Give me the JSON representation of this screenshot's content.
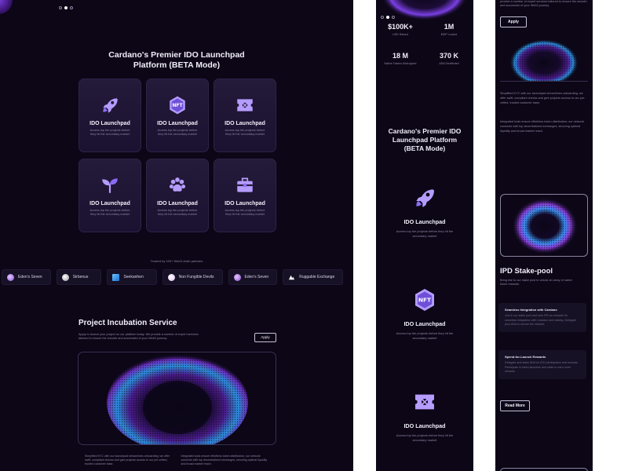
{
  "desktop": {
    "title_line1": "Cardano's Premier IDO Launchpad",
    "title_line2": "Platform (BETA Mode)",
    "cards": [
      {
        "title": "IDO Launchpad",
        "desc": "Access top tier projects before they hit the secondary market",
        "icon": "rocket-icon"
      },
      {
        "title": "IDO Launchpad",
        "desc": "Access top tier projects before they hit the secondary market",
        "icon": "nft-hexagon-icon"
      },
      {
        "title": "IDO Launchpad",
        "desc": "Access top tier projects before they hit the secondary market",
        "icon": "ticket-icon"
      },
      {
        "title": "IDO Launchpad",
        "desc": "Access top tier projects before they hit the secondary market",
        "icon": "sprout-icon"
      },
      {
        "title": "IDO Launchpad",
        "desc": "Access top tier projects before they hit the secondary market",
        "icon": "paw-icon"
      },
      {
        "title": "IDO Launchpad",
        "desc": "Access top tier projects before they hit the secondary market",
        "icon": "toolbox-icon"
      }
    ],
    "trusted": "Trusted by 100+ Web3 chain partners",
    "partners": [
      {
        "name": "Eden's Seven",
        "color": "#c7a0e8"
      },
      {
        "name": "Sirbenus",
        "color": "#d9d9d9"
      },
      {
        "name": "Seekanhen",
        "color": "#3aa0ff"
      },
      {
        "name": "Non Fungible Devils",
        "color": "#f1e6f7"
      },
      {
        "name": "Eden's Seven",
        "color": "#c7a0e8"
      },
      {
        "name": "Ruggable Exchange",
        "color": "#ffffff"
      }
    ],
    "pis_title": "Project Incubation Service",
    "pis_desc": "Apply to launch your project on our platform today. We provide a number of expert services tailored to ensure the smooth and successful of your Web3 journey.",
    "apply": "Apply",
    "footer_left": "Simplified KYC with our launchpad streamlines onboarding; we offer swift, compliant checks and give projects access to our pre-vetted, trusted customer base.",
    "footer_right": "Integrated tools ensure effortless token distribution; our network connects with top decentralized exchanges, securing optimal liquidity and broad market reach."
  },
  "mobile1": {
    "stats": [
      {
        "value": "$100K+",
        "label": "USD Raised"
      },
      {
        "value": "1M",
        "label": "$IDP Locked"
      },
      {
        "value": "18 M",
        "label": "Native Tokens Airdropped"
      },
      {
        "value": "370 K",
        "label": "ADA Distributed"
      }
    ],
    "title_line1": "Cardano's Premier IDO",
    "title_line2": "Launchpad Platform",
    "title_line3": "(BETA Mode)",
    "cards": [
      {
        "title": "IDO Launchpad",
        "desc": "Access top tier projects before they hit the secondary market"
      },
      {
        "title": "IDO Launchpad",
        "desc": "Access top tier projects before they hit the secondary market"
      },
      {
        "title": "IDO Launchpad",
        "desc": "Access top tier projects before they hit the secondary market"
      }
    ]
  },
  "mobile2": {
    "top_text": "provide a number of expert services tailored to ensure the smooth and successful of your Web3 journey.",
    "apply": "Apply",
    "para1": "Simplified KYC with our launchpad streamlines onboarding; we offer swift, compliant checks and give projects access to our pre-vetted, trusted customer base.",
    "para2": "Integrated tools ensure effortless token distribution; our network connects with top decentralized exchanges, securing optimal liquidity and broad market reach.",
    "ipd_title": "IPD Stake-pool",
    "ipd_desc": "Bring rise to our stake pool to unlock an array of native token rewards.",
    "features": [
      {
        "title": "Seamless Integration with Cardano",
        "desc": "Join in our stake pool and earn IPD as rewards for seamless integration with Cardano and staking. Delegate your ADA to secure the network."
      },
      {
        "title": "Spend-for-Launch Rewards",
        "desc": "Delegate and stake ADA for IDO participation and rewards. Participate in token launches and stake to earn more rewards."
      }
    ],
    "read_more": "Read More"
  }
}
